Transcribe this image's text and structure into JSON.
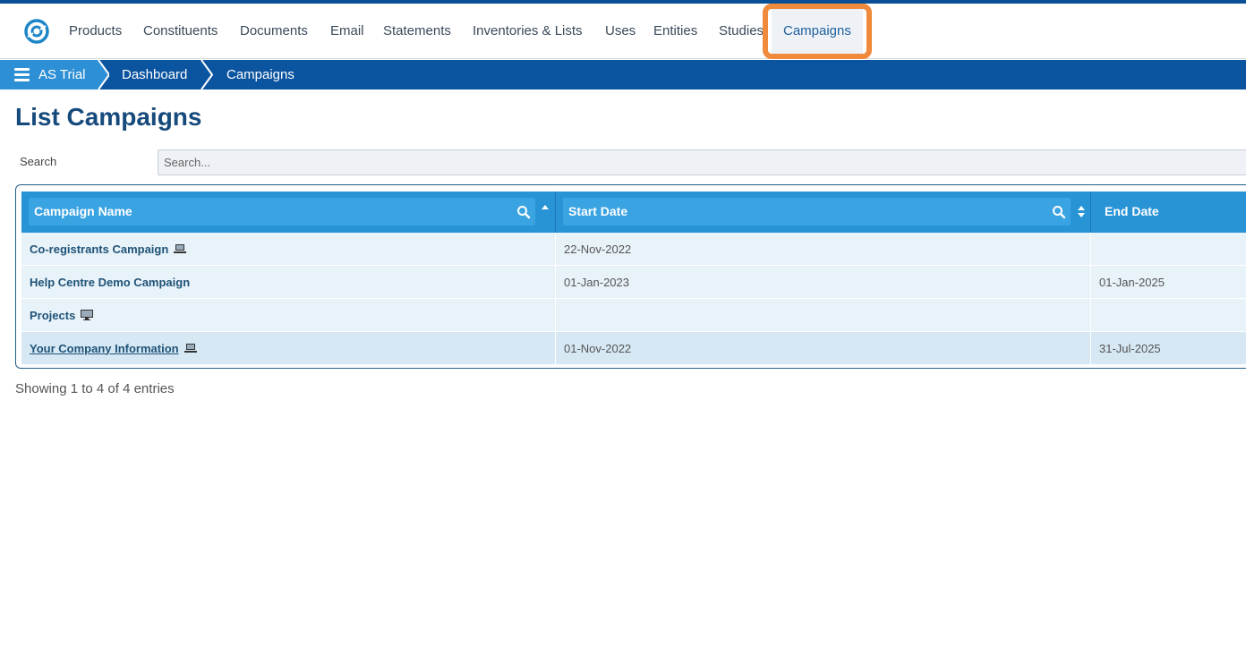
{
  "nav": {
    "items": [
      {
        "label": "Products"
      },
      {
        "label": "Constituents"
      },
      {
        "label": "Documents"
      },
      {
        "label": "Email"
      },
      {
        "label": "Statements"
      },
      {
        "label": "Inventories & Lists"
      },
      {
        "label": "Uses"
      },
      {
        "label": "Entities"
      },
      {
        "label": "Studies"
      },
      {
        "label": "Campaigns",
        "active": true
      }
    ]
  },
  "breadcrumb": {
    "items": [
      {
        "label": "AS Trial"
      },
      {
        "label": "Dashboard"
      },
      {
        "label": "Campaigns"
      }
    ]
  },
  "page": {
    "title": "List Campaigns"
  },
  "search": {
    "label": "Search",
    "placeholder": "Search..."
  },
  "table": {
    "columns": [
      {
        "label": "Campaign Name",
        "sort": "asc"
      },
      {
        "label": "Start Date",
        "sort": "none"
      },
      {
        "label": "End Date",
        "sort": "none"
      }
    ],
    "rows": [
      {
        "name": "Co-registrants Campaign",
        "icon": "laptop-icon",
        "start": "22-Nov-2022",
        "end": ""
      },
      {
        "name": "Help Centre Demo Campaign",
        "icon": "",
        "start": "01-Jan-2023",
        "end": "01-Jan-2025"
      },
      {
        "name": "Projects",
        "icon": "monitor-icon",
        "start": "",
        "end": ""
      },
      {
        "name": "Your Company Information",
        "icon": "laptop-icon",
        "start": "01-Nov-2022",
        "end": "31-Jul-2025",
        "hovered": true
      }
    ]
  },
  "footer": {
    "info": "Showing 1 to 4 of 4 entries"
  },
  "colors": {
    "brand_dark": "#0b549f",
    "brand_light": "#2d8fd5",
    "header_blue": "#2894d6",
    "highlight": "#f08a3c",
    "row_bg": "#e8f2f9",
    "row_hover_bg": "#d6e8f4"
  }
}
